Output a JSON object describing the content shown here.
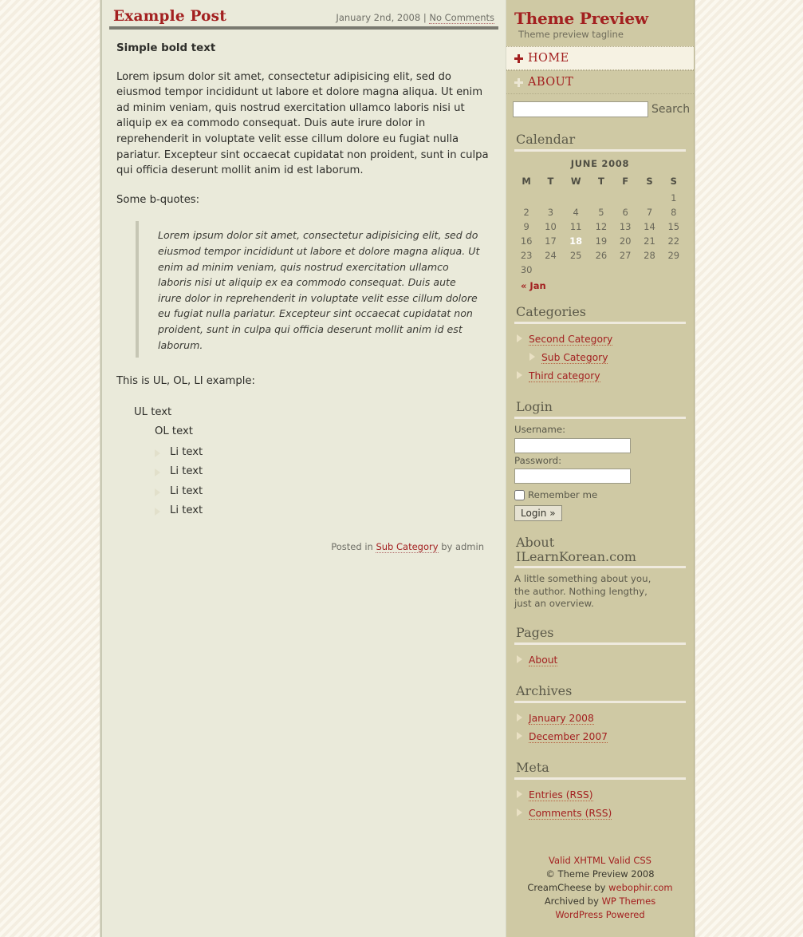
{
  "post": {
    "title": "Example Post",
    "date": "January 2nd, 2008",
    "meta_sep": "|",
    "comments_link": "No Comments",
    "bold_lead": "Simple bold text",
    "paragraph1": "Lorem ipsum dolor sit amet, consectetur adipisicing elit, sed do eiusmod tempor incididunt ut labore et dolore magna aliqua. Ut enim ad minim veniam, quis nostrud exercitation ullamco laboris nisi ut aliquip ex ea commodo consequat. Duis aute irure dolor in reprehenderit in voluptate velit esse cillum dolore eu fugiat nulla pariatur. Excepteur sint occaecat cupidatat non proident, sunt in culpa qui officia deserunt mollit anim id est laborum.",
    "quote_intro": "Some b-quotes:",
    "blockquote": "Lorem ipsum dolor sit amet, consectetur adipisicing elit, sed do eiusmod tempor incididunt ut labore et dolore magna aliqua. Ut enim ad minim veniam, quis nostrud exercitation ullamco laboris nisi ut aliquip ex ea commodo consequat. Duis aute irure dolor in reprehenderit in voluptate velit esse cillum dolore eu fugiat nulla pariatur. Excepteur sint occaecat cupidatat non proident, sunt in culpa qui officia deserunt mollit anim id est laborum.",
    "list_intro": "This is UL, OL, LI example:",
    "ul_text": "UL text",
    "ol_text": "OL text",
    "li_items": [
      "Li text",
      "Li text",
      "Li text",
      "Li text"
    ],
    "footer_prefix": "Posted in",
    "footer_category": "Sub Category",
    "footer_by": "by admin"
  },
  "sidebar": {
    "blog_title": "Theme Preview",
    "tagline": "Theme preview tagline",
    "nav": [
      {
        "label": "HOME",
        "active": true,
        "icon": "move-icon"
      },
      {
        "label": "ABOUT",
        "active": false,
        "icon": "move-icon"
      }
    ],
    "search": {
      "value": "",
      "placeholder": "",
      "button_label": "Search"
    },
    "calendar": {
      "title": "Calendar",
      "caption": "JUNE 2008",
      "weekdays": [
        "M",
        "T",
        "W",
        "T",
        "F",
        "S",
        "S"
      ],
      "weeks": [
        [
          "",
          "",
          "",
          "",
          "",
          "",
          "1"
        ],
        [
          "2",
          "3",
          "4",
          "5",
          "6",
          "7",
          "8"
        ],
        [
          "9",
          "10",
          "11",
          "12",
          "13",
          "14",
          "15"
        ],
        [
          "16",
          "17",
          "18",
          "19",
          "20",
          "21",
          "22"
        ],
        [
          "23",
          "24",
          "25",
          "26",
          "27",
          "28",
          "29"
        ],
        [
          "30",
          "",
          "",
          "",
          "",
          "",
          ""
        ]
      ],
      "today": "18",
      "prev_link": "« Jan"
    },
    "categories": {
      "title": "Categories",
      "items": [
        {
          "label": "Second Category",
          "sub": false
        },
        {
          "label": "Sub Category",
          "sub": true
        },
        {
          "label": "Third category",
          "sub": false
        }
      ]
    },
    "login": {
      "title": "Login",
      "username_label": "Username:",
      "username_value": "",
      "password_label": "Password:",
      "password_value": "",
      "remember_label": "Remember me",
      "remember_checked": false,
      "button_label": "Login »"
    },
    "about": {
      "title": "About ILearnKorean.com",
      "title_line1": "About",
      "title_line2": "ILearnKorean.com",
      "text": "A little something about you, the author. Nothing lengthy, just an overview."
    },
    "pages": {
      "title": "Pages",
      "items": [
        {
          "label": "About",
          "sub": false
        }
      ]
    },
    "archives": {
      "title": "Archives",
      "items": [
        {
          "label": "January 2008",
          "sub": false
        },
        {
          "label": "December 2007",
          "sub": false
        }
      ]
    },
    "meta": {
      "title": "Meta",
      "items": [
        {
          "label": "Entries (RSS)",
          "sub": false
        },
        {
          "label": "Comments (RSS)",
          "sub": false
        }
      ]
    },
    "credits": {
      "line1_a": "Valid XHTML",
      "line1_b": "Valid CSS",
      "line2": "© Theme Preview 2008",
      "line3_prefix": "CreamCheese by",
      "line3_link": "webophir.com",
      "line4_prefix": "Archived by",
      "line4_link": "WP Themes",
      "line5": "WordPress Powered"
    }
  },
  "colors": {
    "accent_red": "#a32020",
    "sidebar_bg": "#cfc9a4",
    "content_bg": "#eaeada",
    "page_bg": "#faf7ec"
  }
}
